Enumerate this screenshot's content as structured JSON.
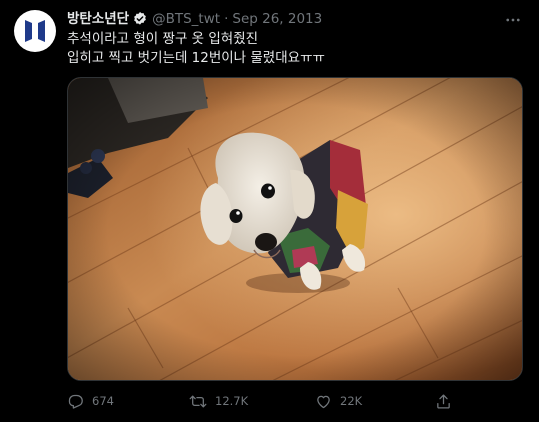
{
  "tweet": {
    "author": {
      "display_name": "방탄소년단",
      "handle": "@BTS_twt",
      "verified_icon": "verified-badge-icon",
      "avatar_icon": "bts-logo-icon"
    },
    "separator": "·",
    "date": "Sep 26, 2013",
    "text_lines": [
      "추석이라고 형이 짱구 옷 입혀줬진",
      "입히고 찍고 벗기는데 12번이나 물렸대요ㅠㅠ"
    ],
    "media": {
      "type": "photo"
    },
    "actions": {
      "reply": {
        "icon": "reply-icon",
        "count": "674"
      },
      "retweet": {
        "icon": "retweet-icon",
        "count": "12.7K"
      },
      "like": {
        "icon": "heart-icon",
        "count": "22K"
      },
      "share": {
        "icon": "share-icon"
      }
    },
    "more_icon": "more-options-icon"
  },
  "colors": {
    "background": "#000000",
    "text_primary": "#e7e9ea",
    "text_secondary": "#71767b",
    "verified_fill": "#1d9bf0",
    "avatar_logo": "#1f3a8a"
  }
}
